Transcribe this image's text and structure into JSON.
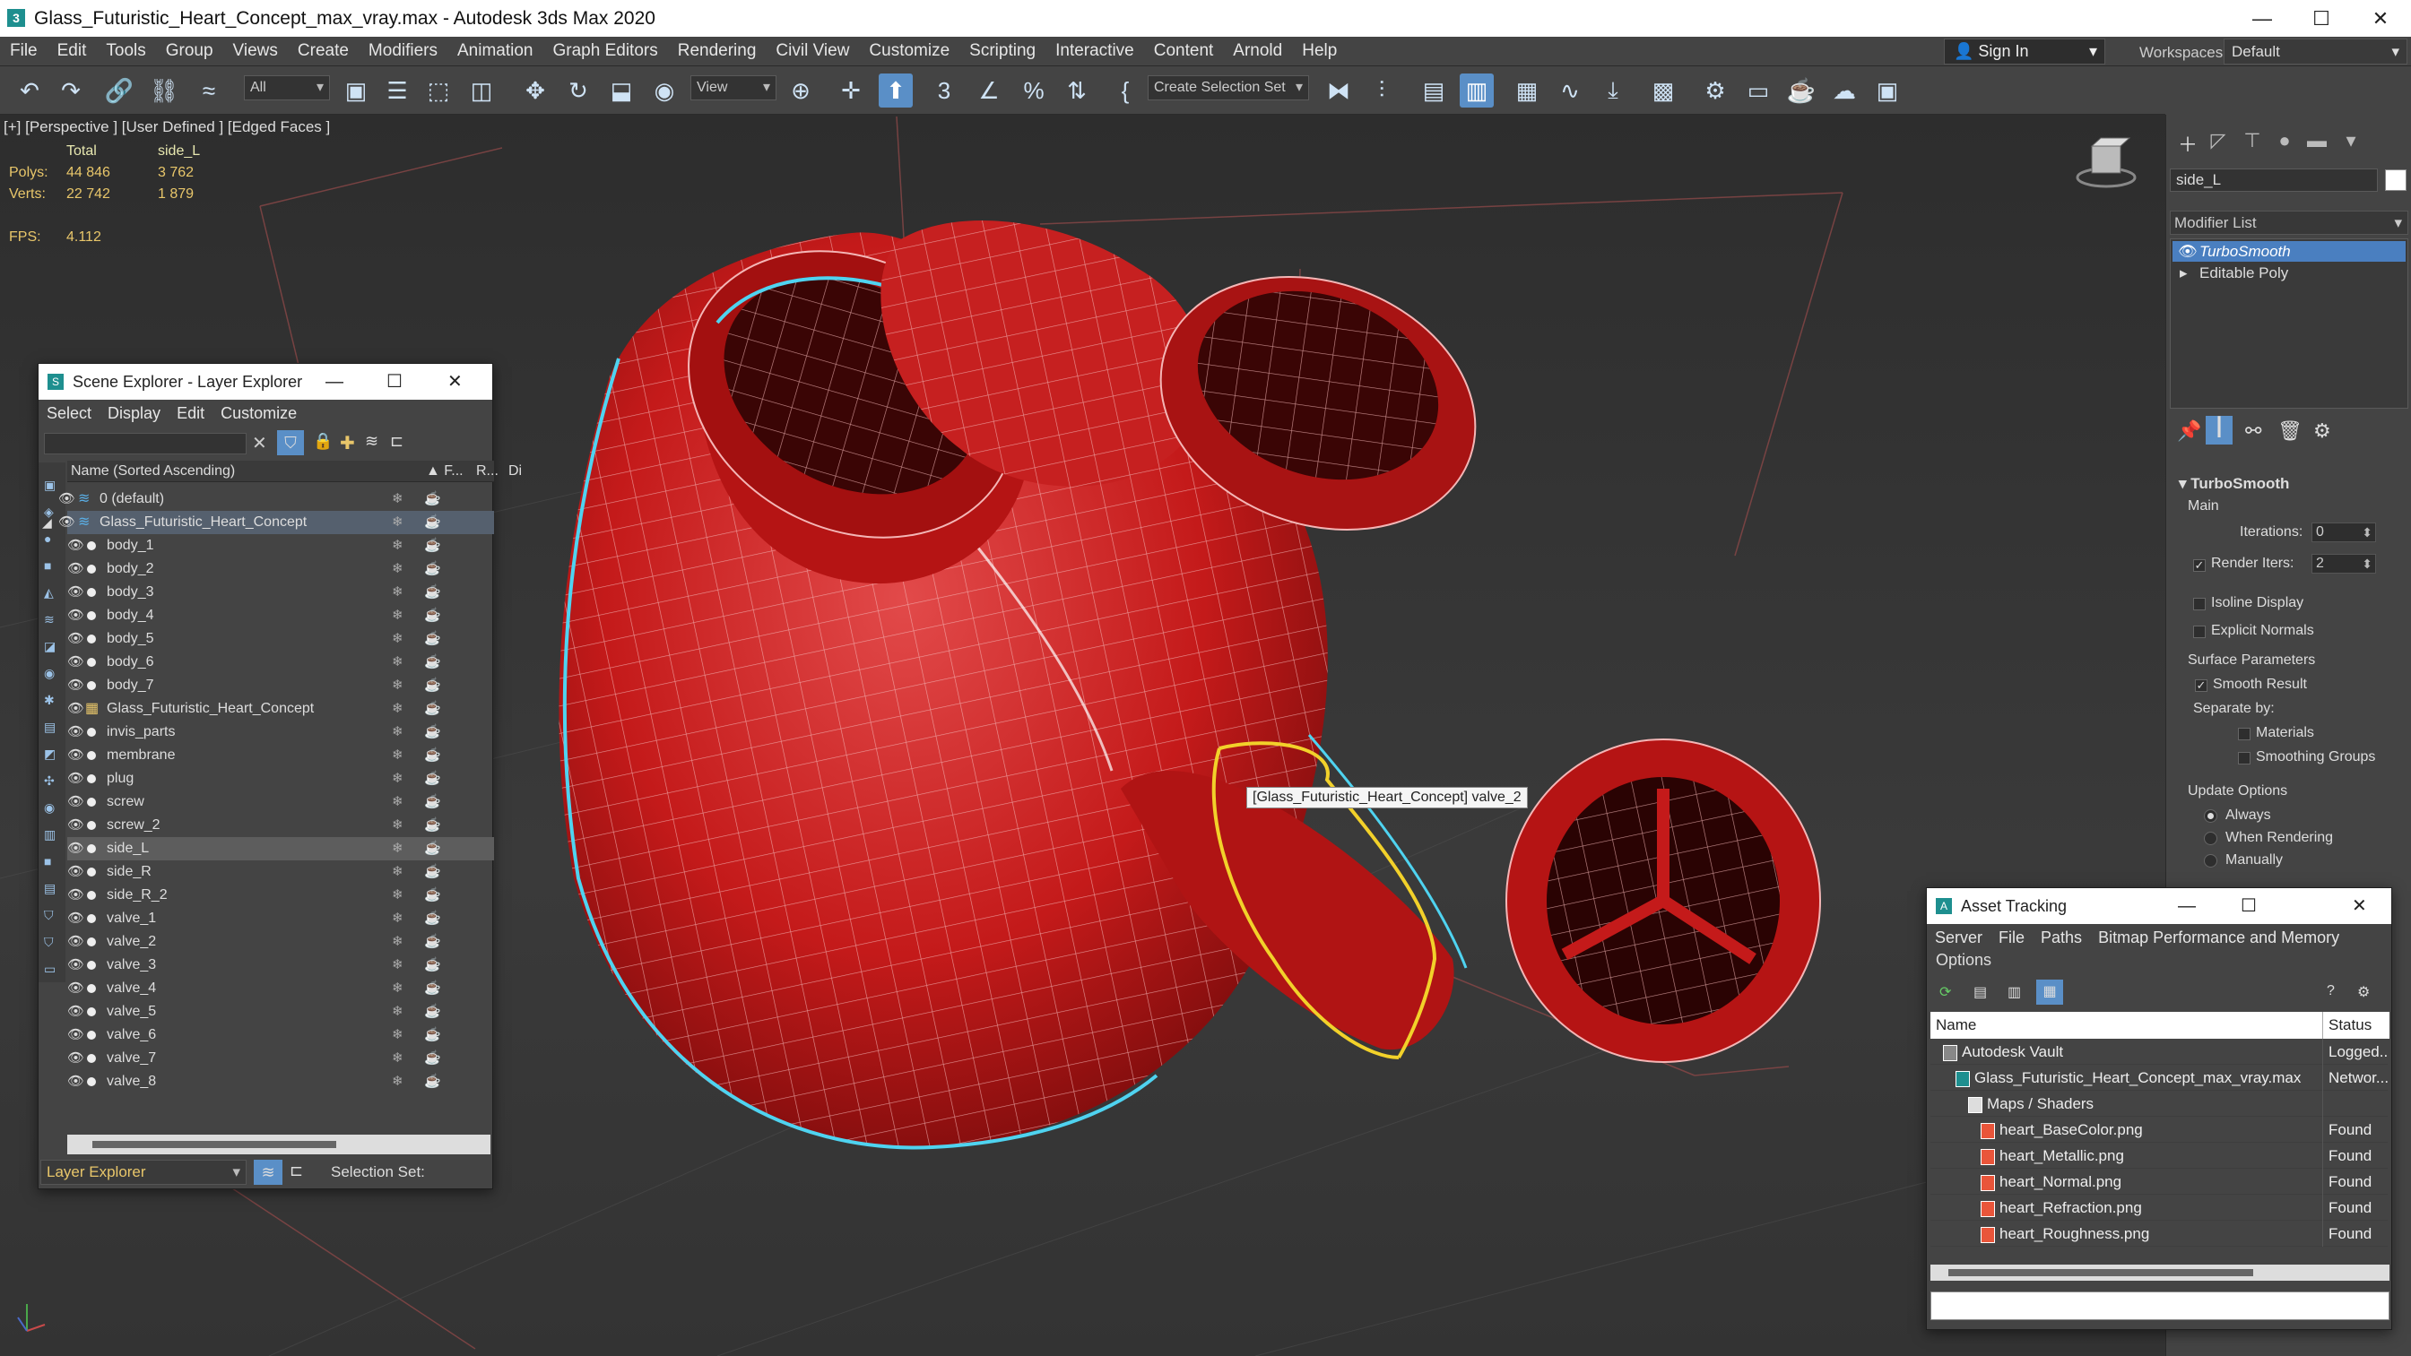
{
  "window": {
    "title": "Glass_Futuristic_Heart_Concept_max_vray.max - Autodesk 3ds Max 2020",
    "app_icon": "3ds-max-icon"
  },
  "menu": [
    "File",
    "Edit",
    "Tools",
    "Group",
    "Views",
    "Create",
    "Modifiers",
    "Animation",
    "Graph Editors",
    "Rendering",
    "Civil View",
    "Customize",
    "Scripting",
    "Interactive",
    "Content",
    "Arnold",
    "Help"
  ],
  "signin": "Sign In",
  "workspaces": {
    "label": "Workspaces:",
    "value": "Default"
  },
  "toolbar": {
    "filter": "All",
    "view_dropdown": "View",
    "selection_set": "Create Selection Set"
  },
  "viewport": {
    "label": "[+] [Perspective ] [User Defined ] [Edged Faces ]",
    "stats": {
      "col_total": "Total",
      "col_sel": "side_L",
      "polys_label": "Polys:",
      "polys_total": "44 846",
      "polys_sel": "3 762",
      "verts_label": "Verts:",
      "verts_total": "22 742",
      "verts_sel": "1 879",
      "fps_label": "FPS:",
      "fps": "4.112"
    },
    "tooltip": "[Glass_Futuristic_Heart_Concept] valve_2"
  },
  "command_panel": {
    "object_name": "side_L",
    "modifier_list": "Modifier List",
    "stack": [
      "TurboSmooth",
      "Editable Poly"
    ],
    "rollout": "TurboSmooth",
    "main_label": "Main",
    "iterations_label": "Iterations:",
    "iterations": "0",
    "render_iters_label": "Render Iters:",
    "render_iters": "2",
    "isoline": "Isoline Display",
    "explicit_normals": "Explicit Normals",
    "surface_params": "Surface Parameters",
    "smooth_result": "Smooth Result",
    "separate_by": "Separate by:",
    "materials": "Materials",
    "smoothing_groups": "Smoothing Groups",
    "update_options": "Update Options",
    "always": "Always",
    "when_rendering": "When Rendering",
    "manually": "Manually"
  },
  "scene_explorer": {
    "title": "Scene Explorer - Layer Explorer",
    "menu": [
      "Select",
      "Display",
      "Edit",
      "Customize"
    ],
    "col_name": "Name (Sorted Ascending)",
    "col_f": "▲ F...",
    "col_r": "R...",
    "col_d": "Di",
    "layers": [
      {
        "name": "0 (default)",
        "indent": 0
      },
      {
        "name": "Glass_Futuristic_Heart_Concept",
        "indent": 0
      }
    ],
    "objects": [
      "body_1",
      "body_2",
      "body_3",
      "body_4",
      "body_5",
      "body_6",
      "body_7",
      "Glass_Futuristic_Heart_Concept",
      "invis_parts",
      "membrane",
      "plug",
      "screw",
      "screw_2",
      "side_L",
      "side_R",
      "side_R_2",
      "valve_1",
      "valve_2",
      "valve_3",
      "valve_4",
      "valve_5",
      "valve_6",
      "valve_7",
      "valve_8"
    ],
    "selected": "side_L",
    "footer_dropdown": "Layer Explorer",
    "selection_set_label": "Selection Set:"
  },
  "asset_tracking": {
    "title": "Asset Tracking",
    "menu": [
      "Server",
      "File",
      "Paths",
      "Bitmap Performance and Memory"
    ],
    "menu2": "Options",
    "col_name": "Name",
    "col_status": "Status",
    "rows": [
      {
        "name": "Autodesk Vault",
        "status": "Logged...",
        "indent": 1,
        "icon": "vault-icon"
      },
      {
        "name": "Glass_Futuristic_Heart_Concept_max_vray.max",
        "status": "Networ...",
        "indent": 2,
        "icon": "max-file-icon"
      },
      {
        "name": "Maps / Shaders",
        "status": "",
        "indent": 3,
        "icon": "folder-icon"
      },
      {
        "name": "heart_BaseColor.png",
        "status": "Found",
        "indent": 4,
        "icon": "image-icon"
      },
      {
        "name": "heart_Metallic.png",
        "status": "Found",
        "indent": 4,
        "icon": "image-icon"
      },
      {
        "name": "heart_Normal.png",
        "status": "Found",
        "indent": 4,
        "icon": "image-icon"
      },
      {
        "name": "heart_Refraction.png",
        "status": "Found",
        "indent": 4,
        "icon": "image-icon"
      },
      {
        "name": "heart_Roughness.png",
        "status": "Found",
        "indent": 4,
        "icon": "image-icon"
      }
    ]
  },
  "colors": {
    "model_red": "#c41a1a",
    "select_cyan": "#4fd3f0",
    "highlight_yellow": "#f2d12a",
    "accent_blue": "#5a8fc7"
  }
}
